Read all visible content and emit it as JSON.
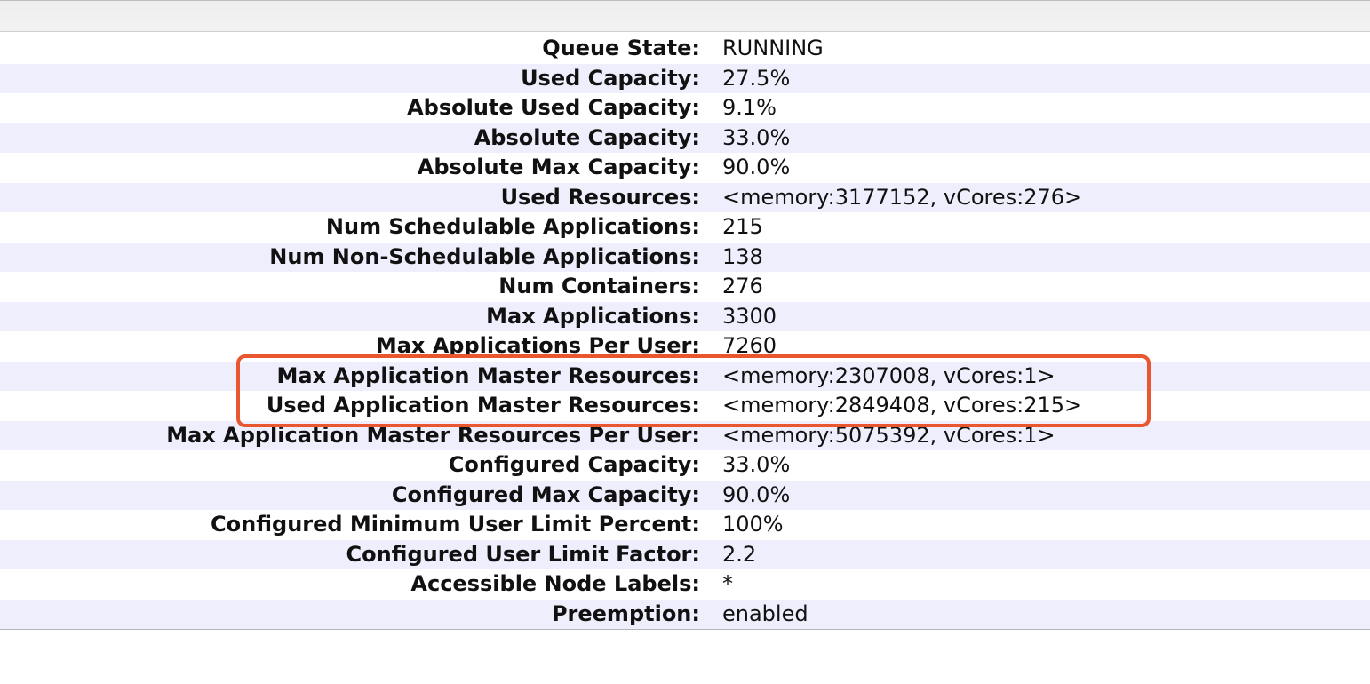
{
  "queue_info": {
    "rows": [
      {
        "label": "Queue State:",
        "value": "RUNNING"
      },
      {
        "label": "Used Capacity:",
        "value": "27.5%"
      },
      {
        "label": "Absolute Used Capacity:",
        "value": "9.1%"
      },
      {
        "label": "Absolute Capacity:",
        "value": "33.0%"
      },
      {
        "label": "Absolute Max Capacity:",
        "value": "90.0%"
      },
      {
        "label": "Used Resources:",
        "value": "<memory:3177152, vCores:276>"
      },
      {
        "label": "Num Schedulable Applications:",
        "value": "215"
      },
      {
        "label": "Num Non-Schedulable Applications:",
        "value": "138"
      },
      {
        "label": "Num Containers:",
        "value": "276"
      },
      {
        "label": "Max Applications:",
        "value": "3300"
      },
      {
        "label": "Max Applications Per User:",
        "value": "7260"
      },
      {
        "label": "Max Application Master Resources:",
        "value": "<memory:2307008, vCores:1>"
      },
      {
        "label": "Used Application Master Resources:",
        "value": "<memory:2849408, vCores:215>"
      },
      {
        "label": "Max Application Master Resources Per User:",
        "value": "<memory:5075392, vCores:1>"
      },
      {
        "label": "Configured Capacity:",
        "value": "33.0%"
      },
      {
        "label": "Configured Max Capacity:",
        "value": "90.0%"
      },
      {
        "label": "Configured Minimum User Limit Percent:",
        "value": "100%"
      },
      {
        "label": "Configured User Limit Factor:",
        "value": "2.2"
      },
      {
        "label": "Accessible Node Labels:",
        "value": "*"
      },
      {
        "label": "Preemption:",
        "value": "enabled"
      }
    ]
  },
  "colors": {
    "row_stripe": "#eeeefc",
    "highlight_border": "#e8572f"
  }
}
